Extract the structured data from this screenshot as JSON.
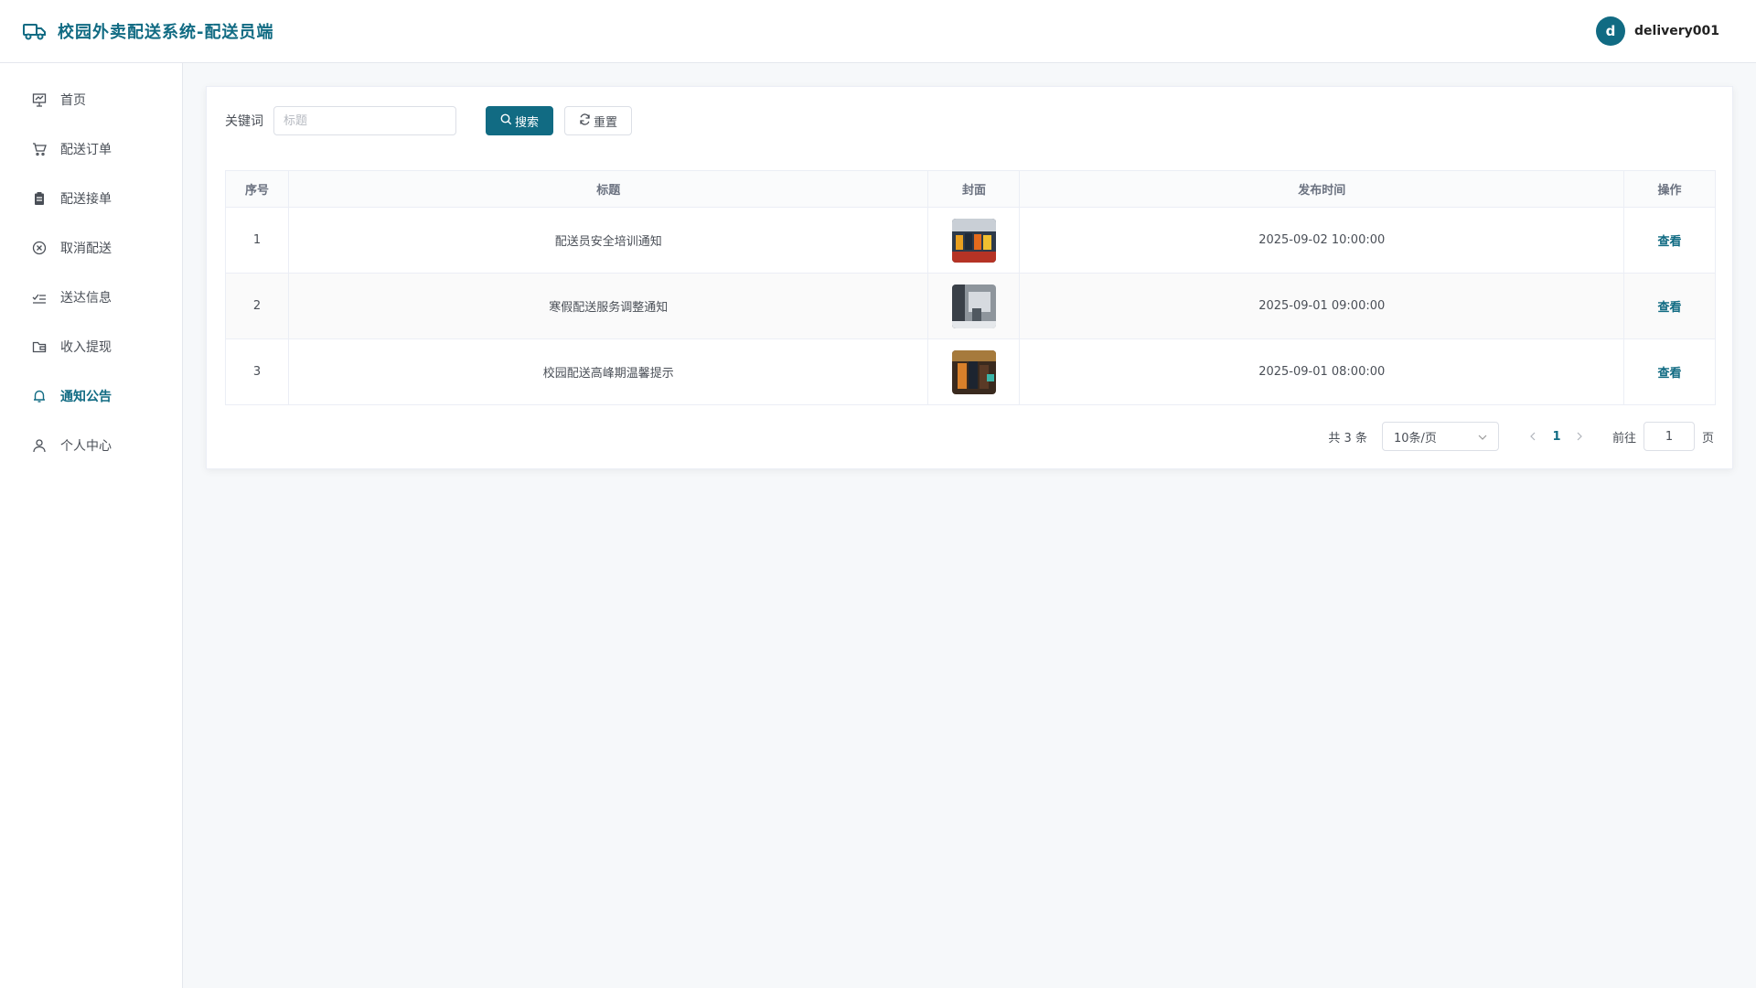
{
  "header": {
    "title": "校园外卖配送系统-配送员端",
    "avatar_initial": "d",
    "username": "delivery001"
  },
  "sidebar": {
    "items": [
      {
        "label": "首页",
        "icon": "presentation-icon"
      },
      {
        "label": "配送订单",
        "icon": "cart-icon"
      },
      {
        "label": "配送接单",
        "icon": "clipboard-icon"
      },
      {
        "label": "取消配送",
        "icon": "circle-x-icon"
      },
      {
        "label": "送达信息",
        "icon": "check-list-icon"
      },
      {
        "label": "收入提现",
        "icon": "wallet-icon"
      },
      {
        "label": "通知公告",
        "icon": "bell-icon",
        "active": true
      },
      {
        "label": "个人中心",
        "icon": "user-icon"
      }
    ]
  },
  "search": {
    "label": "关键词",
    "placeholder": "标题",
    "value": "",
    "search_button": "搜索",
    "reset_button": "重置"
  },
  "table": {
    "headers": [
      "序号",
      "标题",
      "封面",
      "发布时间",
      "操作"
    ],
    "rows": [
      {
        "index": "1",
        "title": "配送员安全培训通知",
        "date": "2025-09-02 10:00:00",
        "action": "查看"
      },
      {
        "index": "2",
        "title": "寒假配送服务调整通知",
        "date": "2025-09-01 09:00:00",
        "action": "查看"
      },
      {
        "index": "3",
        "title": "校园配送高峰期温馨提示",
        "date": "2025-09-01 08:00:00",
        "action": "查看"
      }
    ]
  },
  "pagination": {
    "total_text": "共 3 条",
    "page_size": "10条/页",
    "current_page": "1",
    "goto_label": "前往",
    "goto_value": "1",
    "page_unit": "页"
  },
  "colors": {
    "accent": "#116b83"
  }
}
